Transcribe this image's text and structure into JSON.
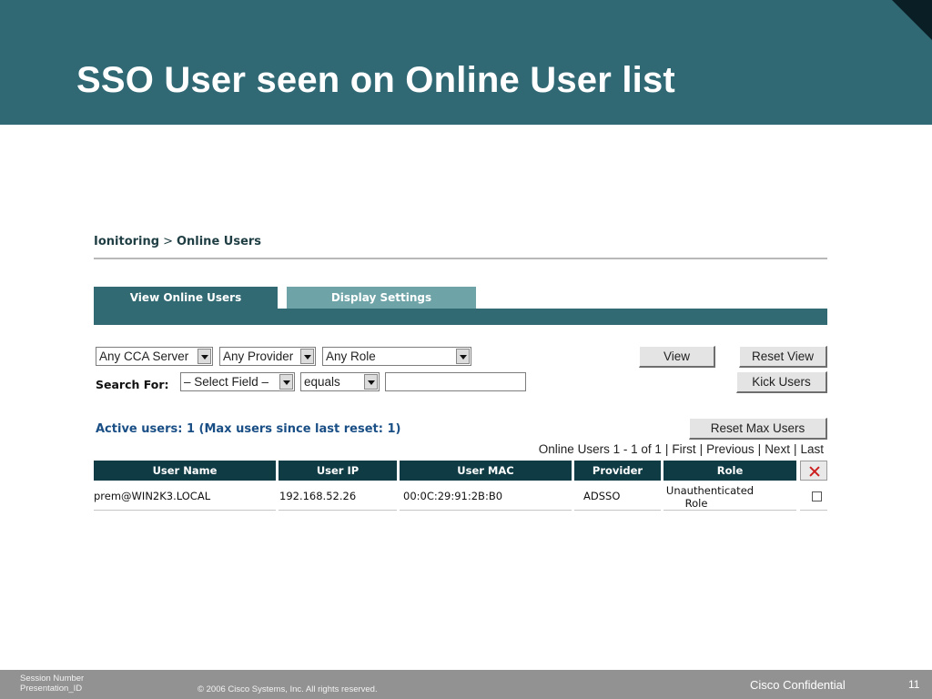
{
  "slide": {
    "title": "SSO User seen on Online User list"
  },
  "breadcrumb": {
    "section": "Ionitoring",
    "separator": ">",
    "page": "Online Users"
  },
  "tabs": [
    {
      "label": "View Online Users",
      "active": true
    },
    {
      "label": "Display Settings",
      "active": false
    }
  ],
  "filters": {
    "server": "Any CCA Server",
    "provider": "Any Provider",
    "role": "Any Role",
    "search_label": "Search For:",
    "field": "– Select Field –",
    "operator": "equals",
    "search_value": ""
  },
  "buttons": {
    "view": "View",
    "reset_view": "Reset View",
    "kick_users": "Kick Users",
    "reset_max_users": "Reset Max Users"
  },
  "status": {
    "active_users": "Active users: 1   (Max users since last reset: 1)"
  },
  "pager": {
    "summary": "Online Users 1 - 1 of 1",
    "first": "First",
    "previous": "Previous",
    "next": "Next",
    "last": "Last"
  },
  "table": {
    "columns": [
      "User Name",
      "User IP",
      "User MAC",
      "Provider",
      "Role"
    ],
    "rows": [
      {
        "user_name": "prem@WIN2K3.LOCAL",
        "user_ip": "192.168.52.26",
        "user_mac": "00:0C:29:91:2B:B0",
        "provider": "ADSSO",
        "role_line1": "Unauthenticated",
        "role_line2": "Role",
        "checked": false
      }
    ]
  },
  "footer": {
    "session_number": "Session Number",
    "presentation_id": "Presentation_ID",
    "copyright": "© 2006 Cisco Systems, Inc. All rights reserved.",
    "confidential": "Cisco Confidential",
    "page_number": "11"
  },
  "colors": {
    "header_bg": "#306874",
    "tab_active": "#316a72",
    "tab_inactive": "#6ea3a7",
    "grid_header": "#0f3b45",
    "status_text": "#1a4f86",
    "footer_bg": "#929292"
  },
  "icons": {
    "delete_column": "close-x-icon",
    "dropdown": "chevron-down-icon"
  }
}
